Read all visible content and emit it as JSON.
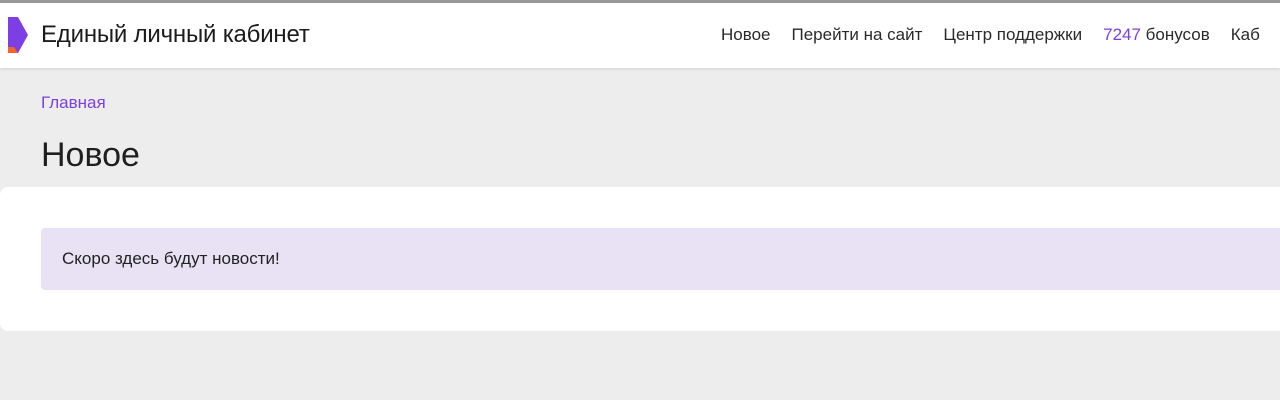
{
  "header": {
    "title": "Единый личный кабинет",
    "logo_icon": "brand-logo-icon",
    "nav": {
      "new": "Новое",
      "go_to_site": "Перейти на сайт",
      "support_center": "Центр поддержки",
      "bonus_count": "7247",
      "bonus_word": "бонусов",
      "cabinet_truncated": "Каб"
    }
  },
  "breadcrumb": {
    "home": "Главная"
  },
  "page": {
    "title": "Новое",
    "notice": "Скоро здесь будут новости!"
  },
  "colors": {
    "accent": "#7b3fe4",
    "notice_bg": "#e9e2f4",
    "page_bg": "#ededed",
    "logo_orange": "#f2652d"
  }
}
